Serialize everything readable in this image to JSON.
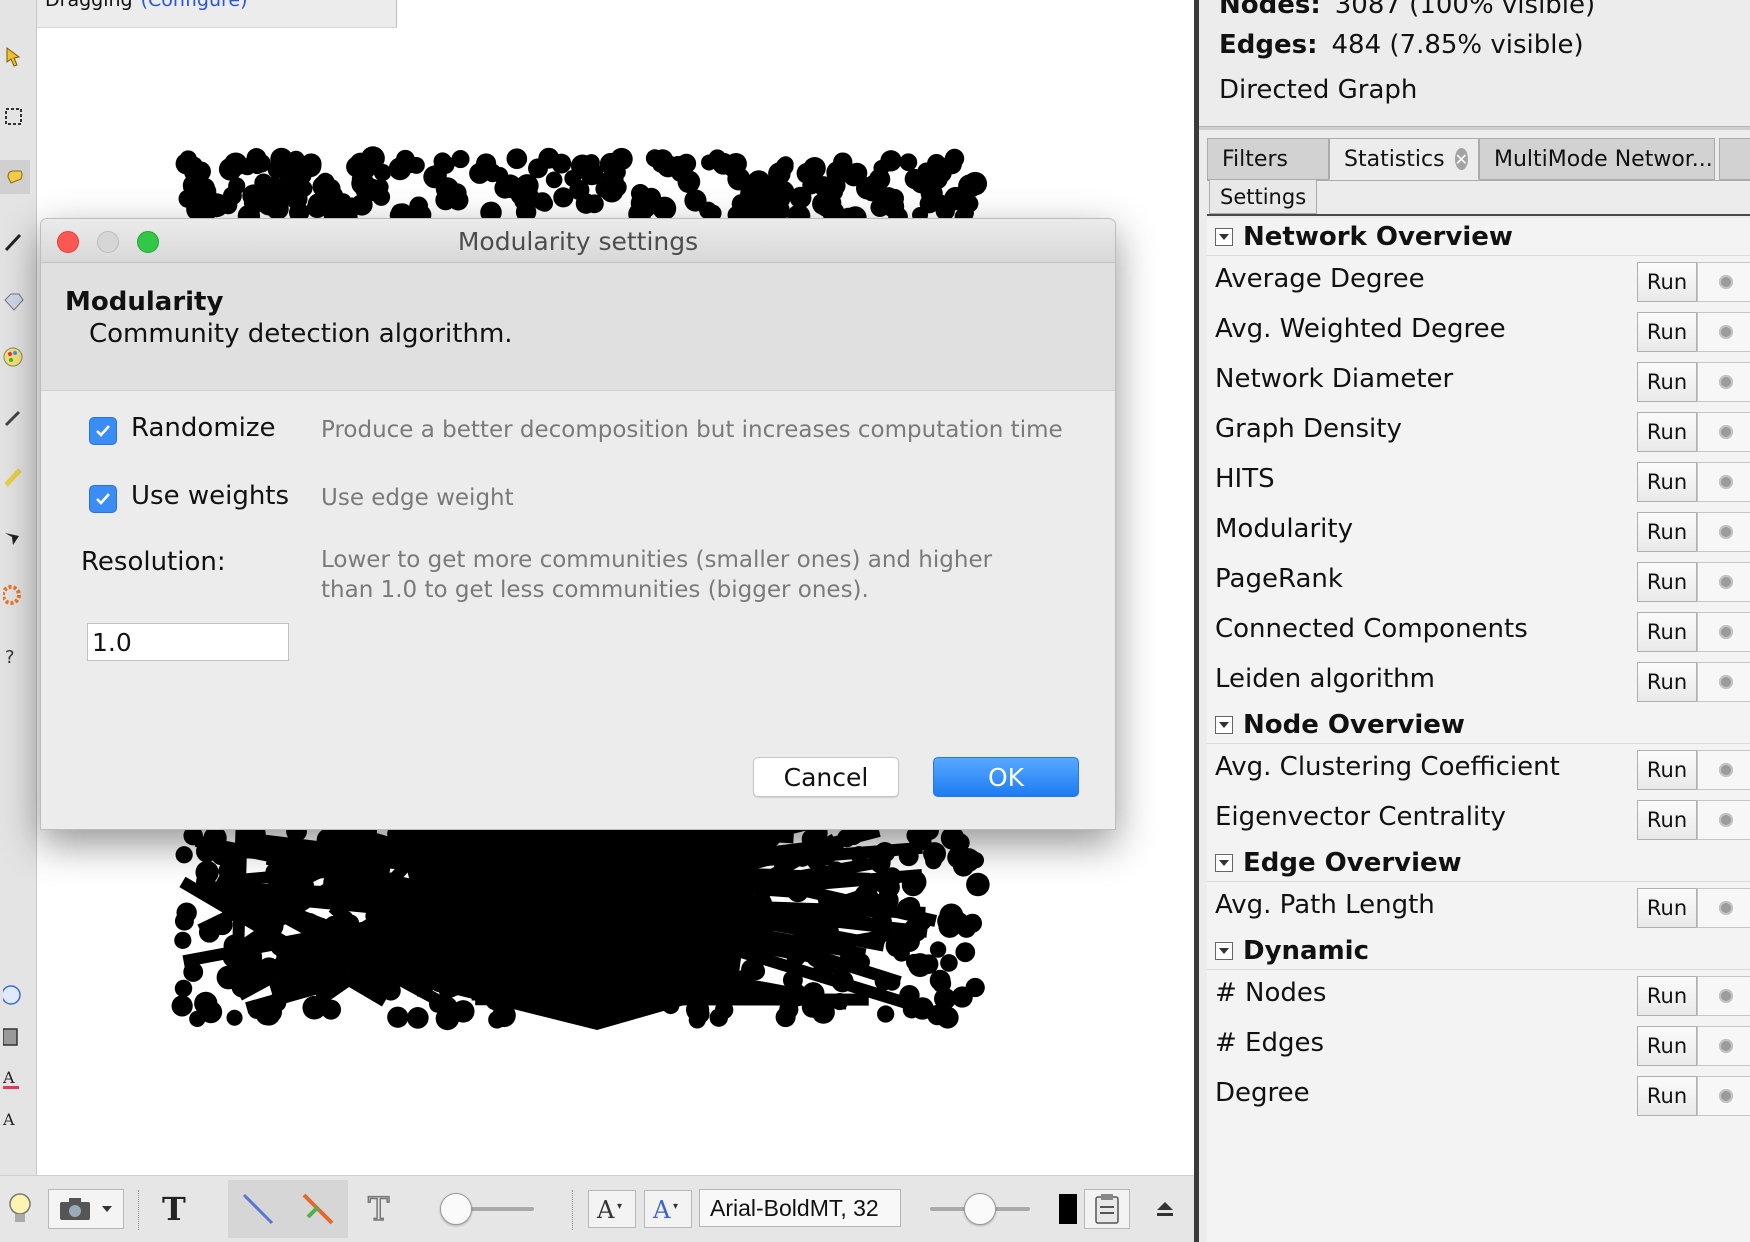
{
  "canvas_header": {
    "mode": "Dragging",
    "configure_link": "(Configure)"
  },
  "context": {
    "nodes_label": "Nodes:",
    "nodes_value": "3087 (100% visible)",
    "edges_label": "Edges:",
    "edges_value": "484 (7.85% visible)",
    "graph_type": "Directed Graph"
  },
  "tabs": [
    {
      "label": "Filters"
    },
    {
      "label": "Statistics",
      "active": true
    },
    {
      "label": "MultiMode Networ..."
    }
  ],
  "settings_button": "Settings",
  "statistics": {
    "run_label": "Run",
    "sections": [
      {
        "title": "Network Overview",
        "items": [
          "Average Degree",
          "Avg. Weighted Degree",
          "Network Diameter",
          "Graph Density",
          "HITS",
          "Modularity",
          "PageRank",
          "Connected Components",
          "Leiden algorithm"
        ]
      },
      {
        "title": "Node Overview",
        "items": [
          "Avg. Clustering Coefficient",
          "Eigenvector Centrality"
        ]
      },
      {
        "title": "Edge Overview",
        "items": [
          "Avg. Path Length"
        ]
      },
      {
        "title": "Dynamic",
        "items": [
          "# Nodes",
          "# Edges",
          "Degree"
        ]
      }
    ]
  },
  "dialog": {
    "title": "Modularity settings",
    "name": "Modularity",
    "description": "Community detection algorithm.",
    "randomize": {
      "label": "Randomize",
      "checked": true,
      "hint": "Produce a better decomposition but increases computation time"
    },
    "use_weights": {
      "label": "Use weights",
      "checked": true,
      "hint": "Use edge weight"
    },
    "resolution": {
      "label": "Resolution:",
      "value": "1.0",
      "hint": "Lower to get more communities (smaller ones) and higher than 1.0 to get less communities (bigger ones)."
    },
    "cancel_label": "Cancel",
    "ok_label": "OK"
  },
  "bottom_toolbar": {
    "font_value": "Arial-BoldMT, 32"
  },
  "colors": {
    "accent": "#1d7cf2",
    "checkbox": "#3a8df5",
    "close_light": "#fc5753",
    "minimize_light": "#d6d6d6",
    "zoom_light": "#33c748",
    "node_color": "#000000"
  },
  "icons": [
    "pointer-icon",
    "rect-select-icon",
    "hand-icon",
    "pencil-icon",
    "diamond-icon",
    "palette-icon",
    "brush-icon",
    "ruler-icon",
    "airplane-icon",
    "gear-icon",
    "question-icon",
    "bulb-icon",
    "camera-icon",
    "text-bold-icon",
    "edge-line-icon",
    "edge-color-icon",
    "text-outline-icon",
    "font-size-icon",
    "font-color-icon",
    "color-swatch-icon",
    "clipboard-icon",
    "eject-icon"
  ]
}
